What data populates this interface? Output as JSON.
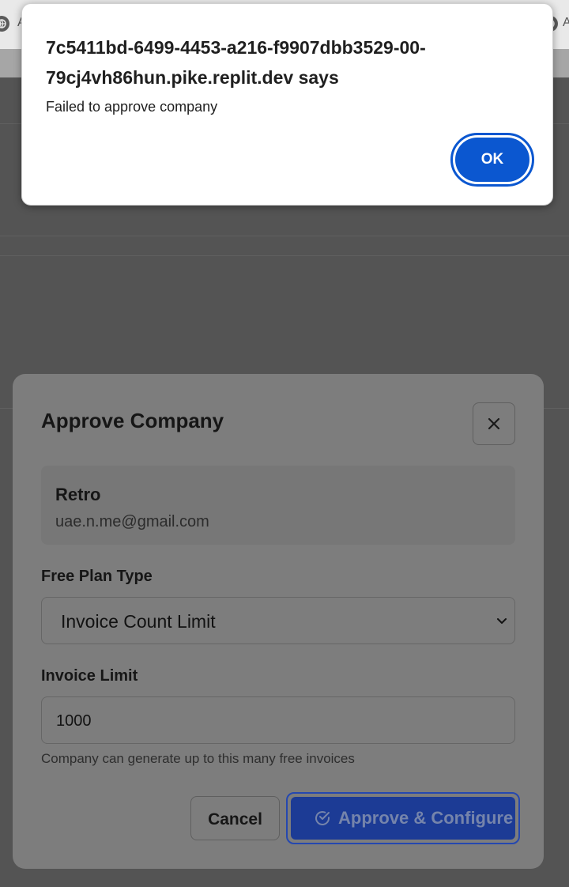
{
  "browser": {
    "tab_left_label": "A",
    "tab_right_label": "A"
  },
  "alert": {
    "origin_text": "7c5411bd-6499-4453-a216-f9907dbb3529-00-79cj4vh86hun.pike.replit.dev says",
    "message": "Failed to approve company",
    "ok_label": "OK"
  },
  "modal": {
    "title": "Approve Company",
    "company": {
      "name": "Retro",
      "email": "uae.n.me@gmail.com"
    },
    "plan_type": {
      "label": "Free Plan Type",
      "selected": "Invoice Count Limit"
    },
    "invoice_limit": {
      "label": "Invoice Limit",
      "value": "1000",
      "helper": "Company can generate up to this many free invoices"
    },
    "cancel_label": "Cancel",
    "approve_label": "Approve & Configure"
  },
  "colors": {
    "ok_button": "#0b57d0",
    "approve_button": "#1c3b95",
    "overlay": "#545454"
  }
}
